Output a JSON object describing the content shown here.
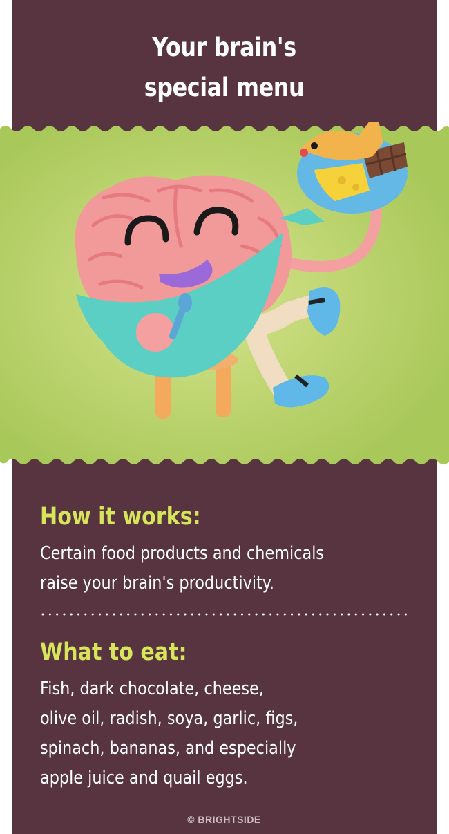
{
  "title": {
    "line1": "Your brain's",
    "line2": "special menu"
  },
  "illustration": {
    "subject": "clay-brain-character-icon",
    "colors": {
      "background": "#bcd46a",
      "brain": "#f29a9a",
      "apron": "#5ccfc4",
      "plate": "#64b8e6"
    }
  },
  "how_it_works": {
    "heading": "How it works:",
    "lines": [
      "Certain food products and chemicals",
      "raise your brain's productivity."
    ]
  },
  "what_to_eat": {
    "heading": "What to eat:",
    "lines": [
      "Fish, dark chocolate, cheese,",
      "olive oil, radish, soya, garlic, figs,",
      "spinach, bananas, and especially",
      "apple juice and quail eggs."
    ]
  },
  "credit": "© BRIGHTSIDE",
  "colors": {
    "card": "#57343f",
    "accent": "#d6e55a",
    "text": "#ffffff"
  }
}
